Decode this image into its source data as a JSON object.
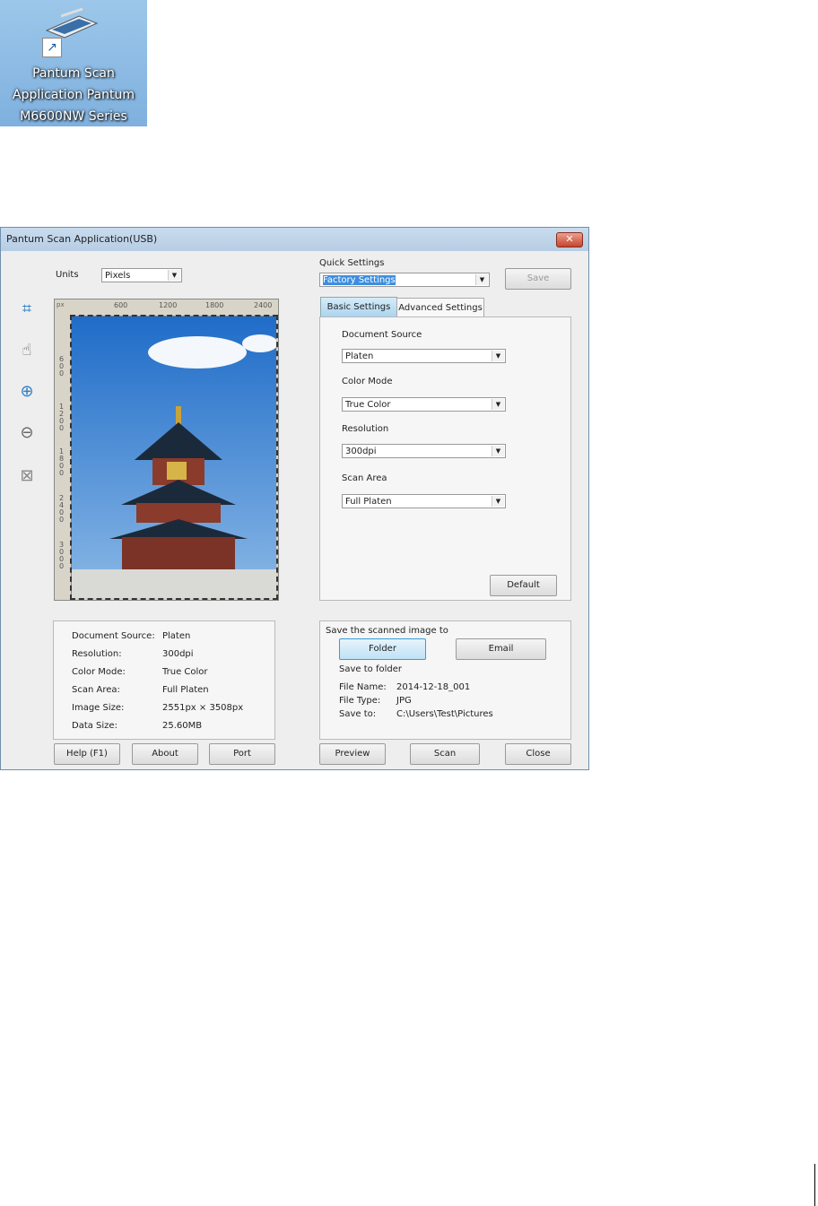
{
  "desktop_icon": {
    "label_lines": [
      "Pantum Scan",
      "Application Pantum",
      "M6600NW Series"
    ]
  },
  "window": {
    "title": "Pantum Scan Application(USB)",
    "close": "✕"
  },
  "units": {
    "label": "Units",
    "value": "Pixels"
  },
  "quick_settings": {
    "label": "Quick Settings",
    "value": "Factory Settings",
    "save": "Save"
  },
  "tools": [
    "crop-icon",
    "hand-icon",
    "zoom-in-icon",
    "zoom-out-icon",
    "delete-icon"
  ],
  "ruler": {
    "unit": "px",
    "top": [
      "600",
      "1200",
      "1800",
      "2400"
    ],
    "left": [
      "600",
      "1200",
      "1800",
      "2400",
      "3000"
    ]
  },
  "tabs": [
    "Basic Settings",
    "Advanced Settings"
  ],
  "basic": {
    "document_source": {
      "label": "Document Source",
      "value": "Platen"
    },
    "color_mode": {
      "label": "Color Mode",
      "value": "True Color"
    },
    "resolution": {
      "label": "Resolution",
      "value": "300dpi"
    },
    "scan_area": {
      "label": "Scan Area",
      "value": "Full Platen"
    },
    "default": "Default"
  },
  "info": [
    {
      "k": "Document Source:",
      "v": "Platen"
    },
    {
      "k": "Resolution:",
      "v": "300dpi"
    },
    {
      "k": "Color Mode:",
      "v": "True Color"
    },
    {
      "k": "Scan Area:",
      "v": "Full Platen"
    },
    {
      "k": "Image Size:",
      "v": "2551px × 3508px"
    },
    {
      "k": "Data Size:",
      "v": "25.60MB"
    }
  ],
  "save": {
    "heading": "Save the scanned image to",
    "folder": "Folder",
    "email": "Email",
    "sub": "Save to folder",
    "rows": [
      {
        "k": "File Name:",
        "v": "2014-12-18_001"
      },
      {
        "k": "File Type:",
        "v": "JPG"
      },
      {
        "k": "Save to:",
        "v": "C:\\Users\\Test\\Pictures"
      }
    ]
  },
  "buttons": {
    "help": "Help (F1)",
    "about": "About",
    "port": "Port",
    "preview": "Preview",
    "scan": "Scan",
    "close": "Close"
  }
}
